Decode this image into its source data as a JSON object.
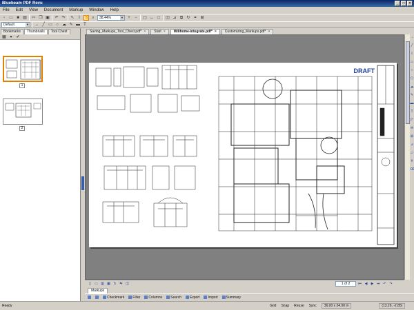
{
  "app": {
    "title": "Bluebeam PDF Revu"
  },
  "window_controls": {
    "minimize": "_",
    "maximize": "□",
    "close": "×"
  },
  "menu": [
    "File",
    "Edit",
    "View",
    "Document",
    "Markup",
    "Window",
    "Help"
  ],
  "toolbar": {
    "zoom_value": "38.44%",
    "profile_value": "Default"
  },
  "left_panel": {
    "tabs": [
      "Bookmarks",
      "Thumbnails",
      "Tool Chest"
    ],
    "selected_tab": "Thumbnails",
    "thumbnails": [
      {
        "label": "1",
        "selected": true
      },
      {
        "label": "2",
        "selected": false
      }
    ]
  },
  "document_tabs": [
    {
      "label": "Saving_Markups_Tool_Chest.pdf*",
      "selected": false
    },
    {
      "label": "Start",
      "selected": false
    },
    {
      "label": "Willhome-integrate.pdf*",
      "selected": true
    },
    {
      "label": "Customizing_Markups.pdf*",
      "selected": false
    }
  ],
  "document": {
    "stamp": "DRAFT"
  },
  "navigation": {
    "page_indicator": "1 of 2"
  },
  "markups": {
    "tab_label": "Markups",
    "toolbar": [
      "Checkmark",
      "Filter",
      "Columns",
      "Search",
      "Export",
      "Import",
      "Summary"
    ]
  },
  "status": {
    "ready": "Ready",
    "items": [
      "Grid",
      "Snap",
      "Reuse",
      "Sync"
    ],
    "dimensions": "36.00 x 24.00 in",
    "coordinates": "(13.26, -2.85)"
  },
  "colors": {
    "accent": "#e08000",
    "title_bar": "#0a246a",
    "draft_stamp": "#1b3c9a",
    "viewer_background": "#808080"
  }
}
